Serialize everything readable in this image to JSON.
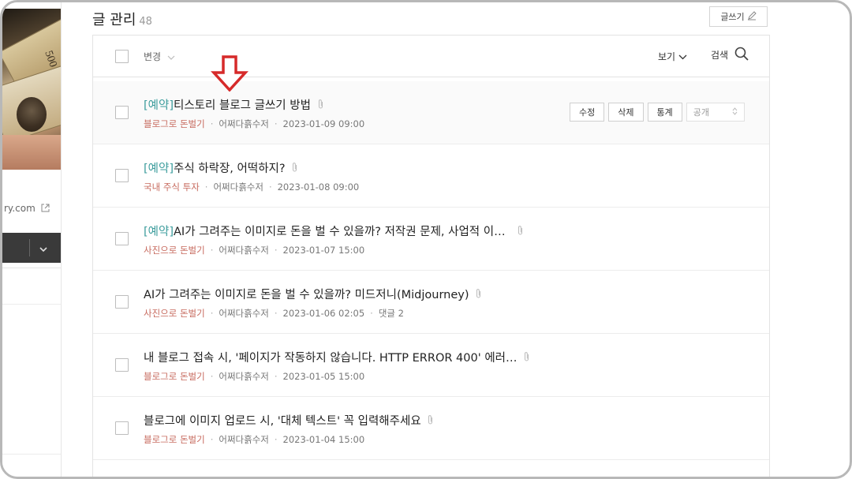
{
  "sidebar": {
    "site_link": "ry.com"
  },
  "header": {
    "title": "글 관리",
    "count": "48",
    "write_label": "글쓰기"
  },
  "toolbar": {
    "change_label": "변경",
    "view_label": "보기",
    "search_label": "검색"
  },
  "posts": [
    {
      "tag": "[예약]",
      "title": "티스토리 블로그 글쓰기 방법",
      "category": "블로그로 돈벌기",
      "author": "어쩌다흙수저",
      "date": "2023-01-09 09:00",
      "comments": ""
    },
    {
      "tag": "[예약]",
      "title": "주식 하락장, 어떡하지?",
      "category": "국내 주식 투자",
      "author": "어쩌다흙수저",
      "date": "2023-01-08 09:00",
      "comments": ""
    },
    {
      "tag": "[예약]",
      "title": "AI가 그려주는 이미지로 돈을 벌 수 있을까? 저작권 문제, 사업적 이…",
      "category": "사진으로 돈벌기",
      "author": "어쩌다흙수저",
      "date": "2023-01-07 15:00",
      "comments": ""
    },
    {
      "tag": "",
      "title": "AI가 그려주는 이미지로 돈을 벌 수 있을까? 미드저니(Midjourney)",
      "category": "사진으로 돈벌기",
      "author": "어쩌다흙수저",
      "date": "2023-01-06 02:05",
      "comments": "댓글 2"
    },
    {
      "tag": "",
      "title": "내 블로그 접속 시, '페이지가 작동하지 않습니다. HTTP ERROR 400' 에러…",
      "category": "블로그로 돈벌기",
      "author": "어쩌다흙수저",
      "date": "2023-01-05 15:00",
      "comments": ""
    },
    {
      "tag": "",
      "title": "블로그에 이미지 업로드 시, '대체 텍스트' 꼭 입력해주세요",
      "category": "블로그로 돈벌기",
      "author": "어쩌다흙수저",
      "date": "2023-01-04 15:00",
      "comments": ""
    }
  ],
  "row_actions": {
    "edit": "수정",
    "delete": "삭제",
    "stats": "통계",
    "visibility": "공개"
  },
  "colors": {
    "tag": "#3b9c9c",
    "category": "#c76a5e",
    "annotation_arrow": "#d62a2a"
  },
  "icons": [
    "external-link-icon",
    "chevron-down-icon",
    "search-icon",
    "pencil-icon",
    "paperclip-icon",
    "sort-arrows-icon",
    "red-down-arrow-icon"
  ]
}
